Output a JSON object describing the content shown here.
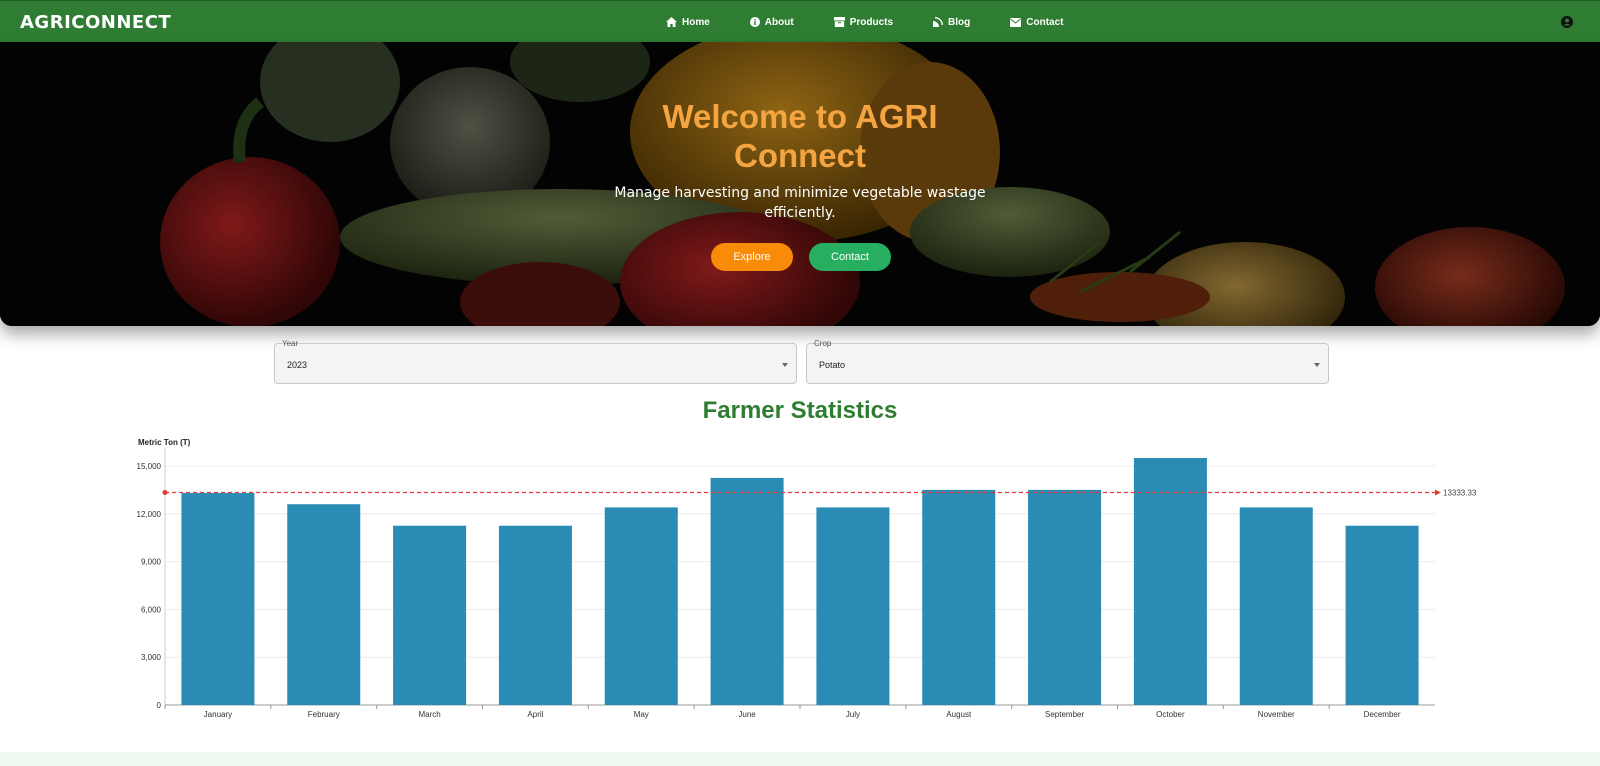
{
  "nav": {
    "brand": "AGRICONNECT",
    "items": [
      {
        "label": "Home",
        "icon": "home-icon"
      },
      {
        "label": "About",
        "icon": "info-icon"
      },
      {
        "label": "Products",
        "icon": "box-icon"
      },
      {
        "label": "Blog",
        "icon": "blog-icon"
      },
      {
        "label": "Contact",
        "icon": "mail-icon"
      }
    ],
    "account_icon": "account-icon"
  },
  "hero": {
    "title": "Welcome to AGRI Connect",
    "subtitle": "Manage harvesting and minimize vegetable wastage efficiently.",
    "explore_label": "Explore",
    "contact_label": "Contact"
  },
  "filters": {
    "year": {
      "label": "Year",
      "value": "2023"
    },
    "crop": {
      "label": "Crop",
      "value": "Potato"
    }
  },
  "colors": {
    "nav_bg": "#2e7d32",
    "title_green": "#2e7d32",
    "hero_title": "#f5a442",
    "explore": "#f88b08",
    "contact": "#27ae60",
    "bar": "#2a8bb5",
    "average_line": "#e53935"
  },
  "section_title": "Farmer Statistics",
  "chart_data": {
    "type": "bar",
    "title": "Farmer Statistics",
    "ylabel": "Metric Ton (T)",
    "xlabel": "",
    "categories": [
      "January",
      "February",
      "March",
      "April",
      "May",
      "June",
      "July",
      "August",
      "September",
      "October",
      "November",
      "December"
    ],
    "values": [
      13300,
      12600,
      11250,
      11250,
      12400,
      14250,
      12400,
      13500,
      13500,
      15500,
      12400,
      11250
    ],
    "ylim": [
      0,
      15500
    ],
    "yticks": [
      0,
      3000,
      6000,
      9000,
      12000,
      15000
    ],
    "ytick_labels": [
      "0",
      "3,000",
      "6,000",
      "9,000",
      "12,000",
      "15,000"
    ],
    "average_line": {
      "value": 13333.33,
      "label": "13333.33"
    },
    "grid": true,
    "legend": "none"
  }
}
